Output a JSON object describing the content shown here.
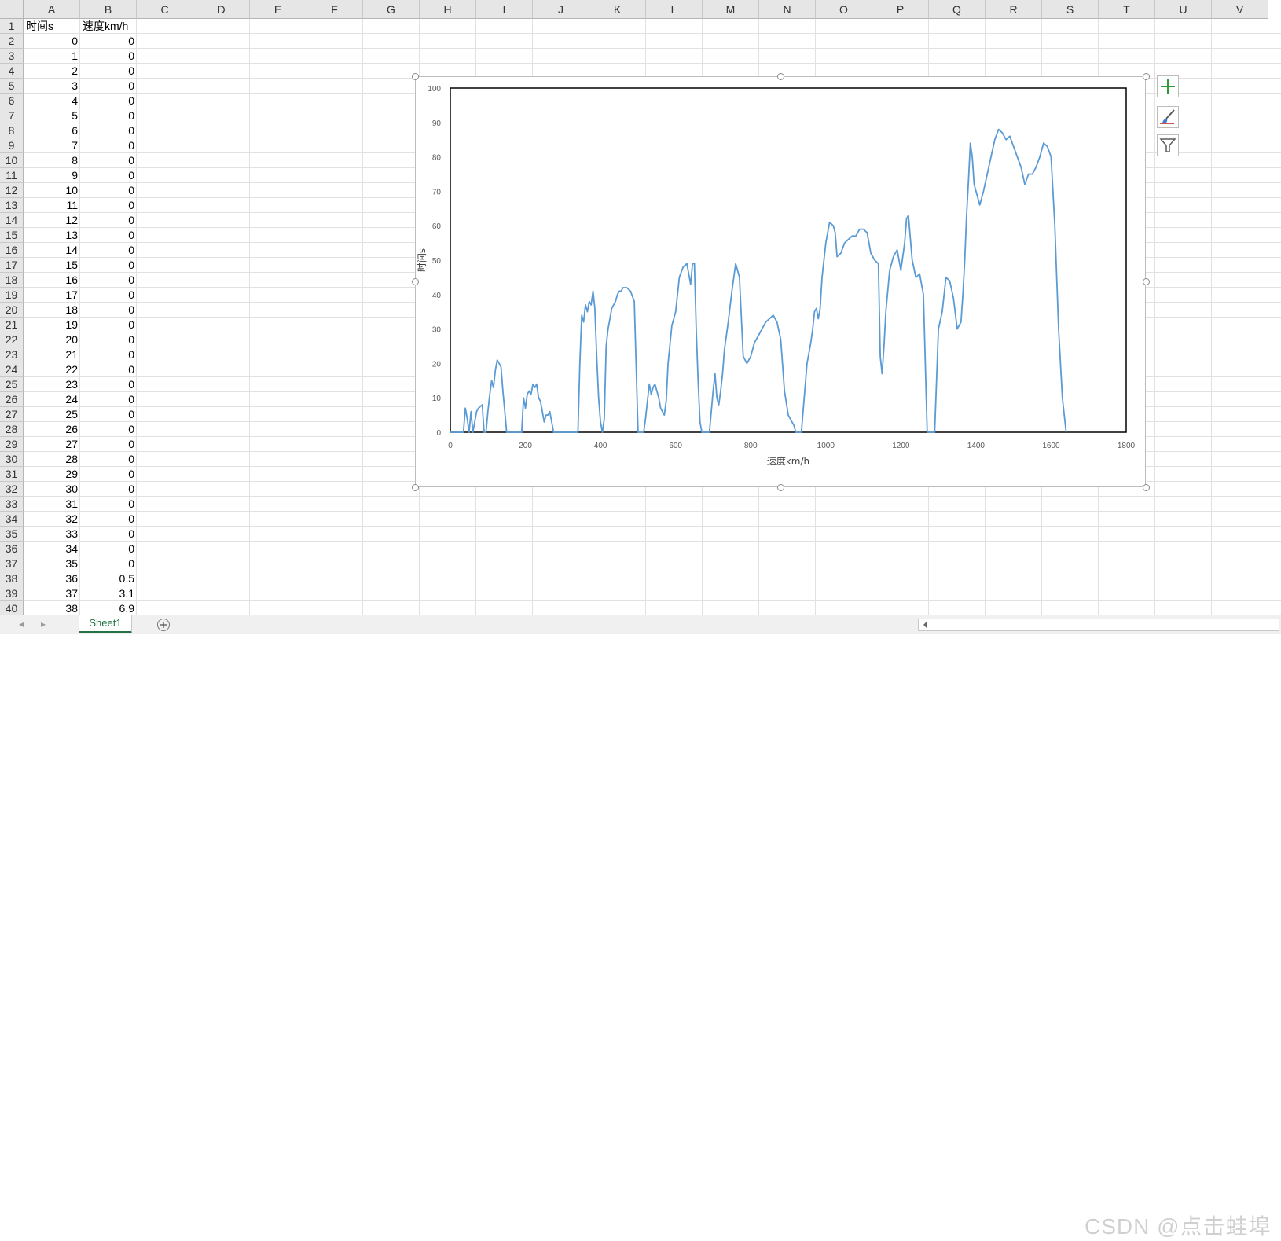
{
  "sheet": {
    "column_headers": [
      "A",
      "B",
      "C",
      "D",
      "E",
      "F",
      "G",
      "H",
      "I",
      "J",
      "K",
      "L",
      "M",
      "N",
      "O",
      "P",
      "Q",
      "R",
      "S",
      "T",
      "U",
      "V"
    ],
    "row_numbers": [
      "1",
      "2",
      "3",
      "4",
      "5",
      "6",
      "7",
      "8",
      "9",
      "10",
      "11",
      "12",
      "13",
      "14",
      "15",
      "16",
      "17",
      "18",
      "19",
      "20",
      "21",
      "22",
      "23",
      "24",
      "25",
      "26",
      "27",
      "28",
      "29",
      "30",
      "31",
      "32",
      "33",
      "34",
      "35",
      "36",
      "37",
      "38",
      "39",
      "40"
    ],
    "header_row": {
      "a": "时间s",
      "b": "速度km/h"
    },
    "rows": [
      {
        "a": "0",
        "b": "0"
      },
      {
        "a": "1",
        "b": "0"
      },
      {
        "a": "2",
        "b": "0"
      },
      {
        "a": "3",
        "b": "0"
      },
      {
        "a": "4",
        "b": "0"
      },
      {
        "a": "5",
        "b": "0"
      },
      {
        "a": "6",
        "b": "0"
      },
      {
        "a": "7",
        "b": "0"
      },
      {
        "a": "8",
        "b": "0"
      },
      {
        "a": "9",
        "b": "0"
      },
      {
        "a": "10",
        "b": "0"
      },
      {
        "a": "11",
        "b": "0"
      },
      {
        "a": "12",
        "b": "0"
      },
      {
        "a": "13",
        "b": "0"
      },
      {
        "a": "14",
        "b": "0"
      },
      {
        "a": "15",
        "b": "0"
      },
      {
        "a": "16",
        "b": "0"
      },
      {
        "a": "17",
        "b": "0"
      },
      {
        "a": "18",
        "b": "0"
      },
      {
        "a": "19",
        "b": "0"
      },
      {
        "a": "20",
        "b": "0"
      },
      {
        "a": "21",
        "b": "0"
      },
      {
        "a": "22",
        "b": "0"
      },
      {
        "a": "23",
        "b": "0"
      },
      {
        "a": "24",
        "b": "0"
      },
      {
        "a": "25",
        "b": "0"
      },
      {
        "a": "26",
        "b": "0"
      },
      {
        "a": "27",
        "b": "0"
      },
      {
        "a": "28",
        "b": "0"
      },
      {
        "a": "29",
        "b": "0"
      },
      {
        "a": "30",
        "b": "0"
      },
      {
        "a": "31",
        "b": "0"
      },
      {
        "a": "32",
        "b": "0"
      },
      {
        "a": "33",
        "b": "0"
      },
      {
        "a": "34",
        "b": "0"
      },
      {
        "a": "35",
        "b": "0"
      },
      {
        "a": "36",
        "b": "0.5"
      },
      {
        "a": "37",
        "b": "3.1"
      },
      {
        "a": "38",
        "b": "6.9"
      }
    ]
  },
  "chart_data": {
    "type": "line",
    "title": "",
    "xlabel": "速度km/h",
    "ylabel": "时间s",
    "xlim": [
      0,
      1800
    ],
    "ylim": [
      0,
      100
    ],
    "x_ticks": [
      "0",
      "200",
      "400",
      "600",
      "800",
      "1000",
      "1200",
      "1400",
      "1600",
      "1800"
    ],
    "y_ticks": [
      "0",
      "10",
      "20",
      "30",
      "40",
      "50",
      "60",
      "70",
      "80",
      "90",
      "100"
    ],
    "grid": false,
    "legend": "none",
    "series_color": "#5b9bd5",
    "x": [
      0,
      35,
      40,
      45,
      50,
      55,
      60,
      70,
      75,
      85,
      90,
      95,
      100,
      105,
      110,
      115,
      120,
      125,
      130,
      135,
      140,
      145,
      150,
      155,
      160,
      175,
      190,
      195,
      200,
      205,
      210,
      215,
      220,
      225,
      230,
      235,
      240,
      245,
      250,
      255,
      260,
      265,
      270,
      275,
      280,
      285,
      330,
      340,
      345,
      350,
      355,
      360,
      365,
      370,
      375,
      380,
      385,
      390,
      395,
      400,
      405,
      410,
      415,
      420,
      425,
      430,
      435,
      440,
      445,
      450,
      455,
      460,
      470,
      480,
      490,
      500,
      510,
      515,
      520,
      525,
      530,
      535,
      540,
      545,
      550,
      555,
      560,
      565,
      570,
      575,
      580,
      590,
      600,
      605,
      610,
      620,
      630,
      635,
      640,
      645,
      650,
      655,
      660,
      665,
      670,
      675,
      680,
      690,
      700,
      705,
      710,
      715,
      720,
      725,
      730,
      740,
      750,
      760,
      770,
      780,
      785,
      790,
      800,
      810,
      820,
      830,
      840,
      850,
      860,
      870,
      880,
      890,
      900,
      910,
      915,
      920,
      925,
      930,
      935,
      950,
      960,
      965,
      970,
      975,
      980,
      985,
      990,
      1000,
      1010,
      1020,
      1025,
      1030,
      1040,
      1050,
      1060,
      1070,
      1080,
      1090,
      1100,
      1110,
      1120,
      1130,
      1140,
      1145,
      1150,
      1155,
      1160,
      1165,
      1170,
      1180,
      1190,
      1200,
      1210,
      1215,
      1220,
      1230,
      1240,
      1250,
      1260,
      1265,
      1270,
      1275,
      1280,
      1285,
      1290,
      1300,
      1310,
      1320,
      1330,
      1340,
      1350,
      1360,
      1365,
      1370,
      1375,
      1380,
      1385,
      1390,
      1395,
      1400,
      1410,
      1420,
      1430,
      1440,
      1450,
      1460,
      1470,
      1480,
      1490,
      1500,
      1510,
      1520,
      1530,
      1540,
      1550,
      1560,
      1570,
      1580,
      1590,
      1600,
      1610,
      1620,
      1630,
      1640,
      1650,
      1660,
      1670,
      1680,
      1690,
      1700,
      1710,
      1720,
      1730,
      1740,
      1750,
      1760,
      1770,
      1775,
      1780
    ],
    "y": [
      0,
      0,
      7,
      4,
      0,
      6,
      0,
      6,
      7,
      8,
      0,
      0,
      6,
      11,
      15,
      13,
      18,
      21,
      20,
      19,
      12,
      6,
      0,
      0,
      0,
      0,
      0,
      10,
      7,
      11,
      12,
      11,
      14,
      13,
      14,
      10,
      9,
      6,
      3,
      5,
      5,
      6,
      3,
      0,
      0,
      0,
      0,
      0,
      20,
      34,
      32,
      37,
      35,
      38,
      37,
      41,
      36,
      22,
      10,
      3,
      0,
      4,
      25,
      30,
      33,
      36,
      37,
      38,
      40,
      41,
      41,
      42,
      42,
      41,
      38,
      0,
      0,
      0,
      4,
      9,
      14,
      11,
      13,
      14,
      12,
      10,
      7,
      6,
      5,
      9,
      20,
      31,
      35,
      40,
      45,
      48,
      49,
      46,
      43,
      49,
      49,
      30,
      15,
      3,
      0,
      0,
      0,
      0,
      12,
      17,
      10,
      8,
      12,
      17,
      24,
      32,
      41,
      49,
      45,
      22,
      21,
      20,
      22,
      26,
      28,
      30,
      32,
      33,
      34,
      32,
      27,
      12,
      5,
      3,
      2,
      0,
      0,
      0,
      0,
      20,
      26,
      30,
      35,
      36,
      33,
      36,
      45,
      55,
      61,
      60,
      58,
      51,
      52,
      55,
      56,
      57,
      57,
      59,
      59,
      58,
      52,
      50,
      49,
      22,
      17,
      25,
      35,
      41,
      47,
      51,
      53,
      47,
      55,
      62,
      63,
      50,
      45,
      46,
      40,
      20,
      0,
      0,
      0,
      0,
      0,
      30,
      35,
      45,
      44,
      39,
      30,
      32,
      40,
      50,
      63,
      73,
      84,
      80,
      72,
      70,
      66,
      70,
      75,
      80,
      85,
      88,
      87,
      85,
      86,
      83,
      80,
      77,
      72,
      75,
      75,
      77,
      80,
      84,
      83,
      80,
      60,
      30,
      10,
      0
    ]
  },
  "tabs": {
    "sheet1_label": "Sheet1",
    "add_symbol": "⊕",
    "prev_arrow": "◂",
    "next_arrow": "▸"
  },
  "watermark": "CSDN @点击蛙埠"
}
